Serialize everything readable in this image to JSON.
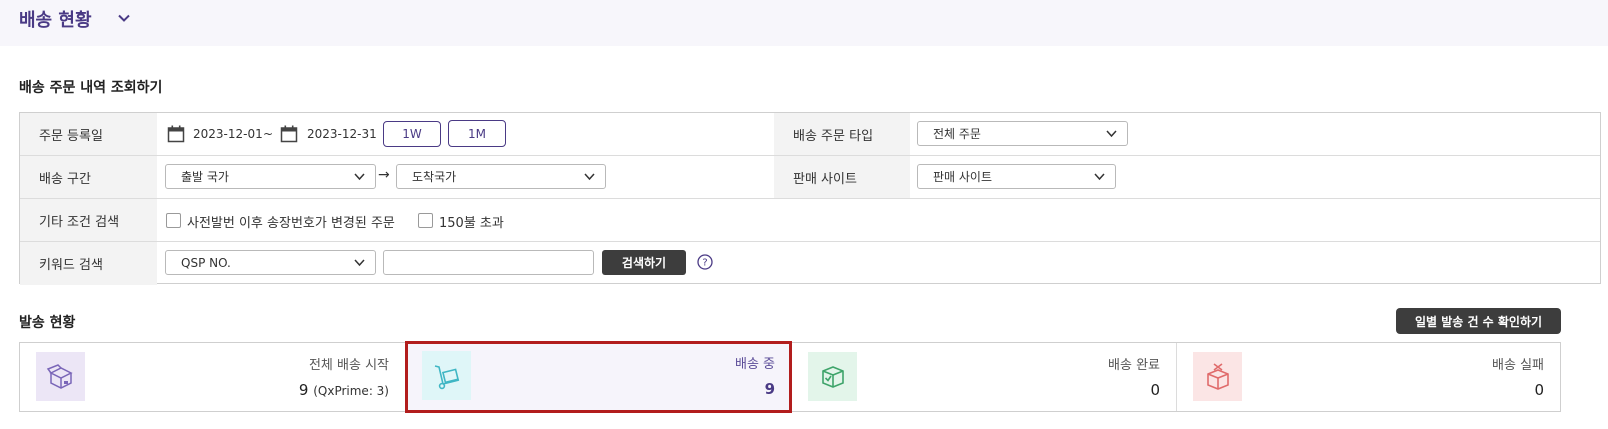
{
  "header": {
    "title": "배송 현황"
  },
  "search": {
    "section_title": "배송 주문 내역 조회하기",
    "order_date": {
      "label": "주문 등록일",
      "start": "2023-12-01",
      "separator": "~",
      "end": "2023-12-31",
      "periods": [
        "1W",
        "1M"
      ]
    },
    "order_type": {
      "label": "배송 주문 타입",
      "value": "전체 주문"
    },
    "route": {
      "label": "배송 구간",
      "origin": "출발 국가",
      "arrow": "→",
      "destination": "도착국가"
    },
    "site": {
      "label": "판매 사이트",
      "value": "판매 사이트"
    },
    "other": {
      "label": "기타 조건 검색",
      "options": [
        "사전발번 이후 송장번호가 변경된 주문",
        "150불 초과"
      ]
    },
    "keyword": {
      "label": "키워드 검색",
      "type": "QSP NO.",
      "value": "",
      "button": "검색하기"
    }
  },
  "shipping": {
    "section_title": "발송 현황",
    "daily_button": "일별 발송 건 수 확인하기",
    "cards": [
      {
        "label": "전체 배송 시작",
        "value": "9",
        "sub": "(QxPrime: 3)",
        "icon": "open-box-icon",
        "icon_bg": "#ece6f6",
        "icon_color": "#7a66b8"
      },
      {
        "label": "배송 중",
        "value": "9",
        "sub": "",
        "icon": "hand-truck-icon",
        "icon_bg": "#dff6f8",
        "icon_color": "#3fb6c4"
      },
      {
        "label": "배송 완료",
        "value": "0",
        "sub": "",
        "icon": "box-check-icon",
        "icon_bg": "#e3f5ea",
        "icon_color": "#3ea46a"
      },
      {
        "label": "배송 실패",
        "value": "0",
        "sub": "",
        "icon": "box-x-icon",
        "icon_bg": "#fbe5e5",
        "icon_color": "#e06b6b"
      }
    ]
  }
}
